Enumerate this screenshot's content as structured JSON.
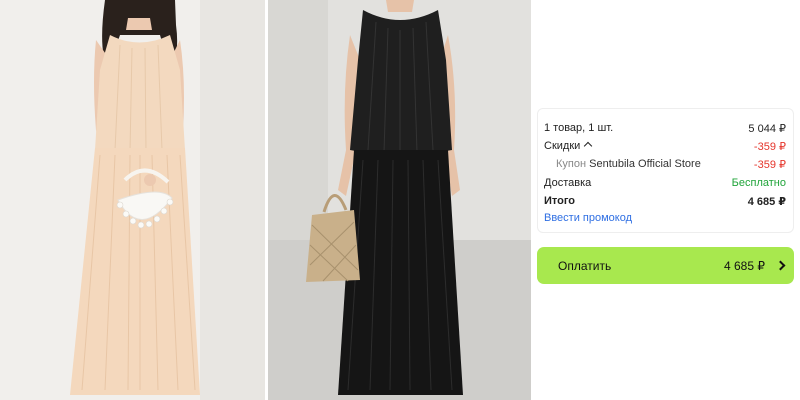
{
  "order_summary": {
    "items_label": "1 товар, 1 шт.",
    "items_value": "5 044 ₽",
    "discounts_label": "Скидки",
    "discounts_value": "-359 ₽",
    "coupon_prefix": "Купон",
    "coupon_store": "Sentubila Official Store",
    "coupon_value": "-359 ₽",
    "delivery_label": "Доставка",
    "delivery_value": "Бесплатно",
    "total_label": "Итого",
    "total_value": "4 685 ₽",
    "promo_link": "Ввести промокод"
  },
  "pay_button": {
    "label": "Оплатить",
    "amount": "4 685 ₽"
  },
  "colors": {
    "pay_button": "#a8e84e",
    "discount": "#e5352b",
    "free_delivery": "#20a43a",
    "link": "#2f6fe3"
  },
  "images": [
    {
      "name": "product-photo-beige",
      "icon": "model-in-beige-dress"
    },
    {
      "name": "product-photo-black",
      "icon": "model-in-black-dress"
    }
  ]
}
